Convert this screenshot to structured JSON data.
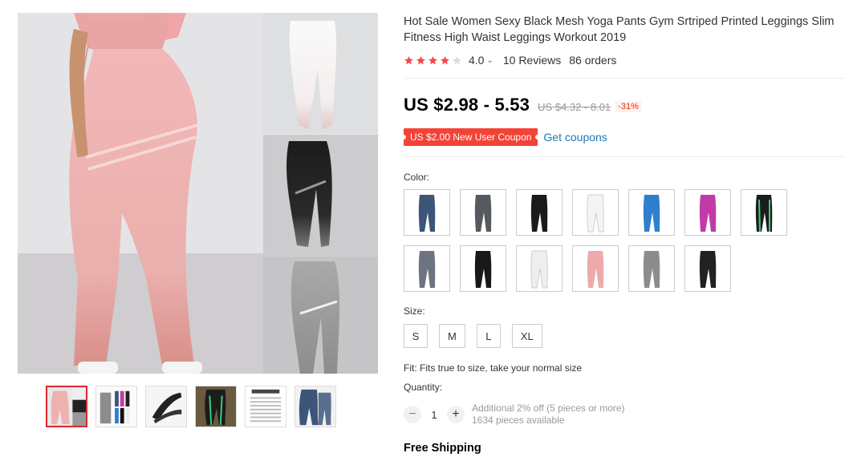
{
  "gallery": {
    "main_image_alt": "Pink, white, black and grey printed high waist leggings",
    "thumbnails": [
      {
        "name": "thumb-pink-collage"
      },
      {
        "name": "thumb-grey-multi"
      },
      {
        "name": "thumb-yoga-pose"
      },
      {
        "name": "thumb-green-stripe"
      },
      {
        "name": "thumb-size-chart",
        "text": "SIZE CHART"
      },
      {
        "name": "thumb-blue-denim"
      }
    ]
  },
  "product": {
    "title": "Hot Sale Women Sexy Black Mesh Yoga Pants Gym Srtriped Printed Leggings Slim Fitness High Waist Leggings Workout 2019",
    "rating_value": "4.0",
    "rating": 4.0,
    "reviews": "10 Reviews",
    "orders": "86 orders",
    "price": "US $2.98 - 5.53",
    "old_price": "US $4.32 - 8.01",
    "discount": "-31%",
    "coupon": "US $2.00 New User Coupon",
    "get_coupons": "Get coupons",
    "color_label": "Color:",
    "colors": [
      {
        "name": "blue-denim",
        "fill": "#3c5578"
      },
      {
        "name": "grey-denim",
        "fill": "#555a60"
      },
      {
        "name": "black-white-stripe",
        "fill": "#1a1a1a"
      },
      {
        "name": "white",
        "fill": "#f4f4f4"
      },
      {
        "name": "blue",
        "fill": "#2f7fcf"
      },
      {
        "name": "magenta",
        "fill": "#c23aa8"
      },
      {
        "name": "black-green-stripe",
        "fill": "#1c1c1c"
      },
      {
        "name": "camo-grey",
        "fill": "#6d7380"
      },
      {
        "name": "black-stripe",
        "fill": "#181818"
      },
      {
        "name": "white-stripe",
        "fill": "#eeeeee"
      },
      {
        "name": "pink",
        "fill": "#eeaaaa"
      },
      {
        "name": "grey",
        "fill": "#8c8c8c"
      },
      {
        "name": "black-sparkle",
        "fill": "#222222"
      }
    ],
    "size_label": "Size:",
    "sizes": [
      "S",
      "M",
      "L",
      "XL"
    ],
    "fit": "Fit: Fits true to size, take your normal size",
    "quantity_label": "Quantity:",
    "quantity": "1",
    "additional_off": "Additional 2% off (5 pieces or more)",
    "available": "1634 pieces available",
    "shipping": "Free Shipping"
  },
  "colors": {
    "accent": "#f44336",
    "link": "#1a7ab3",
    "star": "#f5474b"
  }
}
